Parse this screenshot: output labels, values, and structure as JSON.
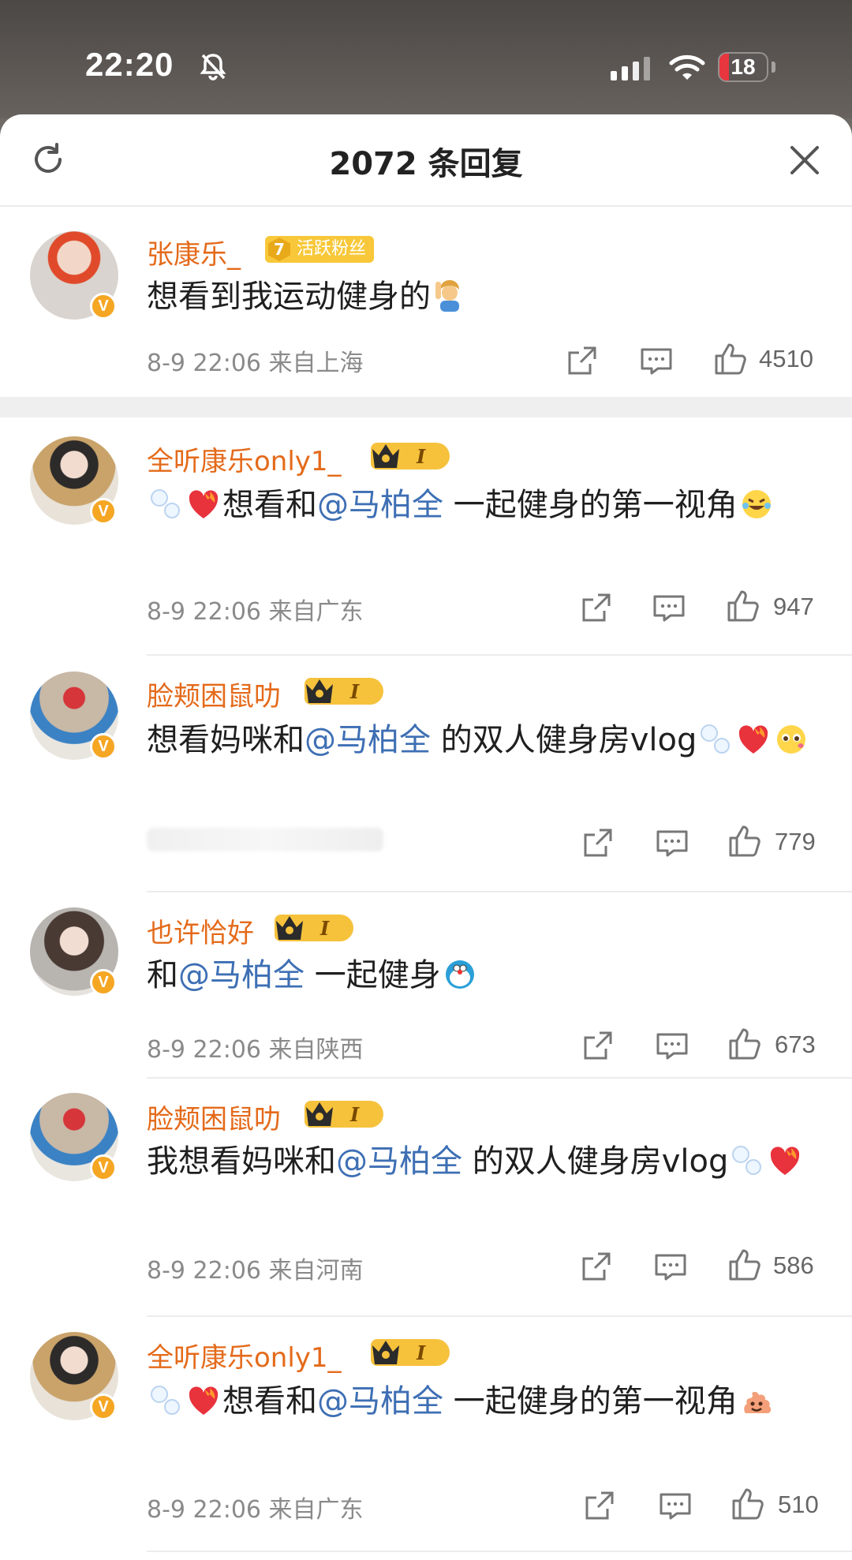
{
  "status_bar": {
    "time": "22:20",
    "battery": "18"
  },
  "header": {
    "title": "2072 条回复"
  },
  "comments": [
    {
      "user": "张康乐_",
      "fan_level": "7",
      "fan_badge": "活跃粉丝",
      "segments": [
        {
          "t": "想看到我运动健身的",
          "mention": false
        }
      ],
      "emojis_after": [
        "person-raising-hand"
      ],
      "time": "8-9 22:06",
      "location": "来自上海",
      "likes": "4510"
    },
    {
      "user": "全听康乐only1_",
      "vip_level": "I",
      "segments": [
        {
          "t": "想看和",
          "mention": false
        },
        {
          "t": "@马柏全",
          "mention": true
        },
        {
          "t": " 一起健身的第一视角",
          "mention": false
        }
      ],
      "time": "8-9 22:06",
      "location": "来自广东",
      "likes": "947"
    },
    {
      "user": "脸颊困鼠叻",
      "vip_level": "I",
      "segments": [
        {
          "t": "想看妈咪和",
          "mention": false
        },
        {
          "t": "@马柏全",
          "mention": true
        },
        {
          "t": " 的双人健身房vlog",
          "mention": false
        }
      ],
      "time": "",
      "location": "",
      "likes": "779"
    },
    {
      "user": "也许恰好",
      "vip_level": "I",
      "segments": [
        {
          "t": "和",
          "mention": false
        },
        {
          "t": "@马柏全",
          "mention": true
        },
        {
          "t": " 一起健身",
          "mention": false
        }
      ],
      "time": "8-9 22:06",
      "location": "来自陕西",
      "likes": "673"
    },
    {
      "user": "脸颊困鼠叻",
      "vip_level": "I",
      "segments": [
        {
          "t": "我想看妈咪和",
          "mention": false
        },
        {
          "t": "@马柏全",
          "mention": true
        },
        {
          "t": " 的双人健身房vlog",
          "mention": false
        }
      ],
      "time": "8-9 22:06",
      "location": "来自河南",
      "likes": "586"
    },
    {
      "user": "全听康乐only1_",
      "vip_level": "I",
      "segments": [
        {
          "t": "想看和",
          "mention": false
        },
        {
          "t": "@马柏全",
          "mention": true
        },
        {
          "t": " 一起健身的第一视角",
          "mention": false
        }
      ],
      "time": "8-9 22:06",
      "location": "来自广东",
      "likes": "510"
    }
  ],
  "icons": {
    "share": "share-icon",
    "reply": "comment-icon",
    "like": "thumb-up-icon",
    "refresh": "refresh-icon",
    "close": "close-icon"
  },
  "colors": {
    "username": "#e46a1a",
    "mention": "#3e6fb4",
    "meta": "#8a8a8a",
    "vip_badge": "#f6c23c"
  }
}
